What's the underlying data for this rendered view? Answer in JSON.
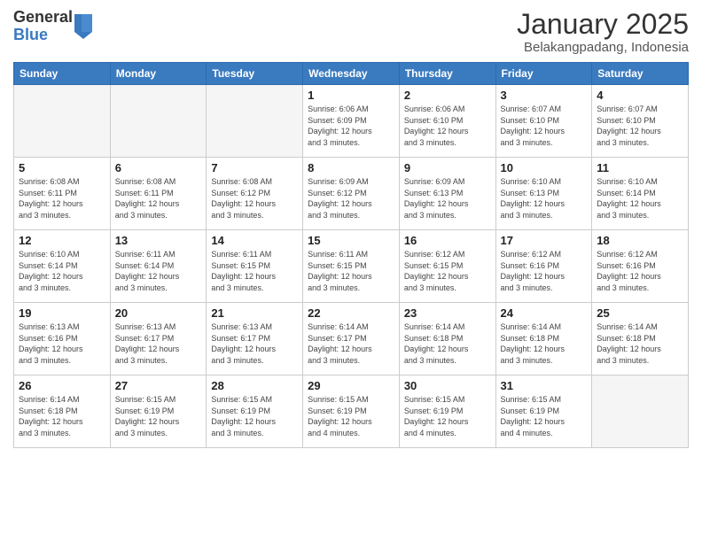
{
  "header": {
    "logo_line1": "General",
    "logo_line2": "Blue",
    "month": "January 2025",
    "location": "Belakangpadang, Indonesia"
  },
  "weekdays": [
    "Sunday",
    "Monday",
    "Tuesday",
    "Wednesday",
    "Thursday",
    "Friday",
    "Saturday"
  ],
  "weeks": [
    [
      {
        "day": "",
        "info": ""
      },
      {
        "day": "",
        "info": ""
      },
      {
        "day": "",
        "info": ""
      },
      {
        "day": "1",
        "info": "Sunrise: 6:06 AM\nSunset: 6:09 PM\nDaylight: 12 hours\nand 3 minutes."
      },
      {
        "day": "2",
        "info": "Sunrise: 6:06 AM\nSunset: 6:10 PM\nDaylight: 12 hours\nand 3 minutes."
      },
      {
        "day": "3",
        "info": "Sunrise: 6:07 AM\nSunset: 6:10 PM\nDaylight: 12 hours\nand 3 minutes."
      },
      {
        "day": "4",
        "info": "Sunrise: 6:07 AM\nSunset: 6:10 PM\nDaylight: 12 hours\nand 3 minutes."
      }
    ],
    [
      {
        "day": "5",
        "info": "Sunrise: 6:08 AM\nSunset: 6:11 PM\nDaylight: 12 hours\nand 3 minutes."
      },
      {
        "day": "6",
        "info": "Sunrise: 6:08 AM\nSunset: 6:11 PM\nDaylight: 12 hours\nand 3 minutes."
      },
      {
        "day": "7",
        "info": "Sunrise: 6:08 AM\nSunset: 6:12 PM\nDaylight: 12 hours\nand 3 minutes."
      },
      {
        "day": "8",
        "info": "Sunrise: 6:09 AM\nSunset: 6:12 PM\nDaylight: 12 hours\nand 3 minutes."
      },
      {
        "day": "9",
        "info": "Sunrise: 6:09 AM\nSunset: 6:13 PM\nDaylight: 12 hours\nand 3 minutes."
      },
      {
        "day": "10",
        "info": "Sunrise: 6:10 AM\nSunset: 6:13 PM\nDaylight: 12 hours\nand 3 minutes."
      },
      {
        "day": "11",
        "info": "Sunrise: 6:10 AM\nSunset: 6:14 PM\nDaylight: 12 hours\nand 3 minutes."
      }
    ],
    [
      {
        "day": "12",
        "info": "Sunrise: 6:10 AM\nSunset: 6:14 PM\nDaylight: 12 hours\nand 3 minutes."
      },
      {
        "day": "13",
        "info": "Sunrise: 6:11 AM\nSunset: 6:14 PM\nDaylight: 12 hours\nand 3 minutes."
      },
      {
        "day": "14",
        "info": "Sunrise: 6:11 AM\nSunset: 6:15 PM\nDaylight: 12 hours\nand 3 minutes."
      },
      {
        "day": "15",
        "info": "Sunrise: 6:11 AM\nSunset: 6:15 PM\nDaylight: 12 hours\nand 3 minutes."
      },
      {
        "day": "16",
        "info": "Sunrise: 6:12 AM\nSunset: 6:15 PM\nDaylight: 12 hours\nand 3 minutes."
      },
      {
        "day": "17",
        "info": "Sunrise: 6:12 AM\nSunset: 6:16 PM\nDaylight: 12 hours\nand 3 minutes."
      },
      {
        "day": "18",
        "info": "Sunrise: 6:12 AM\nSunset: 6:16 PM\nDaylight: 12 hours\nand 3 minutes."
      }
    ],
    [
      {
        "day": "19",
        "info": "Sunrise: 6:13 AM\nSunset: 6:16 PM\nDaylight: 12 hours\nand 3 minutes."
      },
      {
        "day": "20",
        "info": "Sunrise: 6:13 AM\nSunset: 6:17 PM\nDaylight: 12 hours\nand 3 minutes."
      },
      {
        "day": "21",
        "info": "Sunrise: 6:13 AM\nSunset: 6:17 PM\nDaylight: 12 hours\nand 3 minutes."
      },
      {
        "day": "22",
        "info": "Sunrise: 6:14 AM\nSunset: 6:17 PM\nDaylight: 12 hours\nand 3 minutes."
      },
      {
        "day": "23",
        "info": "Sunrise: 6:14 AM\nSunset: 6:18 PM\nDaylight: 12 hours\nand 3 minutes."
      },
      {
        "day": "24",
        "info": "Sunrise: 6:14 AM\nSunset: 6:18 PM\nDaylight: 12 hours\nand 3 minutes."
      },
      {
        "day": "25",
        "info": "Sunrise: 6:14 AM\nSunset: 6:18 PM\nDaylight: 12 hours\nand 3 minutes."
      }
    ],
    [
      {
        "day": "26",
        "info": "Sunrise: 6:14 AM\nSunset: 6:18 PM\nDaylight: 12 hours\nand 3 minutes."
      },
      {
        "day": "27",
        "info": "Sunrise: 6:15 AM\nSunset: 6:19 PM\nDaylight: 12 hours\nand 3 minutes."
      },
      {
        "day": "28",
        "info": "Sunrise: 6:15 AM\nSunset: 6:19 PM\nDaylight: 12 hours\nand 3 minutes."
      },
      {
        "day": "29",
        "info": "Sunrise: 6:15 AM\nSunset: 6:19 PM\nDaylight: 12 hours\nand 4 minutes."
      },
      {
        "day": "30",
        "info": "Sunrise: 6:15 AM\nSunset: 6:19 PM\nDaylight: 12 hours\nand 4 minutes."
      },
      {
        "day": "31",
        "info": "Sunrise: 6:15 AM\nSunset: 6:19 PM\nDaylight: 12 hours\nand 4 minutes."
      },
      {
        "day": "",
        "info": ""
      }
    ]
  ]
}
